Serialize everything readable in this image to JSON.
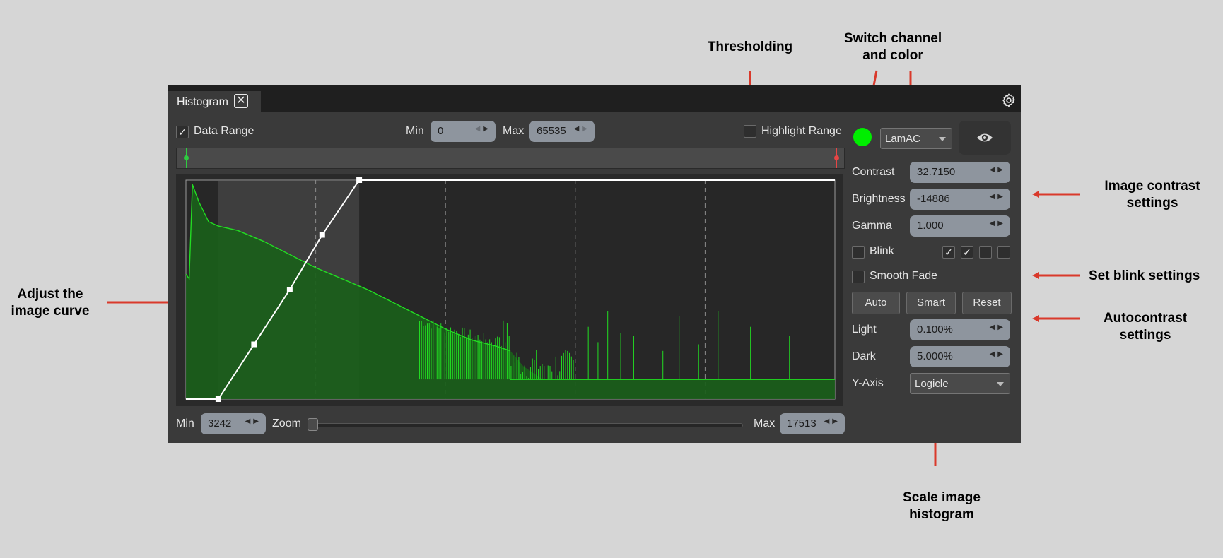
{
  "annotations": {
    "thresholding": "Thresholding",
    "switch_channel": [
      "Switch channel",
      "and color"
    ],
    "image_contrast": [
      "Image contrast",
      "settings"
    ],
    "blink": "Set blink settings",
    "autocontrast": [
      "Autocontrast",
      "settings"
    ],
    "adjust_curve": [
      "Adjust the",
      "image curve"
    ],
    "scale_histogram": [
      "Scale image",
      "histogram"
    ],
    "arrow_color": "#d9392b"
  },
  "panel": {
    "tab_title": "Histogram",
    "close_icon": "close-icon",
    "settings_icon": "gear-icon"
  },
  "top_row": {
    "data_range_label": "Data Range",
    "data_range_checked": true,
    "min_label": "Min",
    "min_value": "0",
    "max_label": "Max",
    "max_value": "65535",
    "highlight_label": "Highlight Range",
    "highlight_checked": false
  },
  "bottom_row": {
    "min_label": "Min",
    "min_value": "3242",
    "zoom_label": "Zoom",
    "max_label": "Max",
    "max_value": "17513"
  },
  "controls": {
    "channel_color": "#00ee00",
    "channel": "LamAC",
    "contrast_label": "Contrast",
    "contrast_value": "32.7150",
    "brightness_label": "Brightness",
    "brightness_value": "-14886",
    "gamma_label": "Gamma",
    "gamma_value": "1.000",
    "blink_label": "Blink",
    "blink_boxes": [
      true,
      true,
      false,
      false
    ],
    "smooth_fade_label": "Smooth Fade",
    "auto_label": "Auto",
    "smart_label": "Smart",
    "reset_label": "Reset",
    "light_label": "Light",
    "light_value": "0.100%",
    "dark_label": "Dark",
    "dark_value": "5.000%",
    "yaxis_label": "Y-Axis",
    "yaxis_value": "Logicle"
  },
  "chart_data": {
    "type": "area",
    "color": "#1a5e1a",
    "line_color": "#22dd22",
    "grid": "vertical dashed",
    "curve_points_fraction": [
      [
        0.05,
        0
      ],
      [
        0.105,
        0.25
      ],
      [
        0.16,
        0.5
      ],
      [
        0.21,
        0.75
      ],
      [
        0.267,
        1
      ]
    ],
    "histogram_profile": [
      [
        0.0,
        0.57
      ],
      [
        0.005,
        0.55
      ],
      [
        0.01,
        0.98
      ],
      [
        0.02,
        0.9
      ],
      [
        0.035,
        0.81
      ],
      [
        0.05,
        0.79
      ],
      [
        0.08,
        0.77
      ],
      [
        0.12,
        0.72
      ],
      [
        0.16,
        0.66
      ],
      [
        0.2,
        0.6
      ],
      [
        0.24,
        0.55
      ],
      [
        0.28,
        0.5
      ],
      [
        0.32,
        0.44
      ],
      [
        0.36,
        0.38
      ],
      [
        0.4,
        0.32
      ],
      [
        0.44,
        0.27
      ],
      [
        0.48,
        0.24
      ],
      [
        0.5,
        0.22
      ],
      [
        0.52,
        0.15
      ],
      [
        0.55,
        0.09
      ],
      [
        0.58,
        0.09
      ],
      [
        1.0,
        0.09
      ]
    ]
  }
}
